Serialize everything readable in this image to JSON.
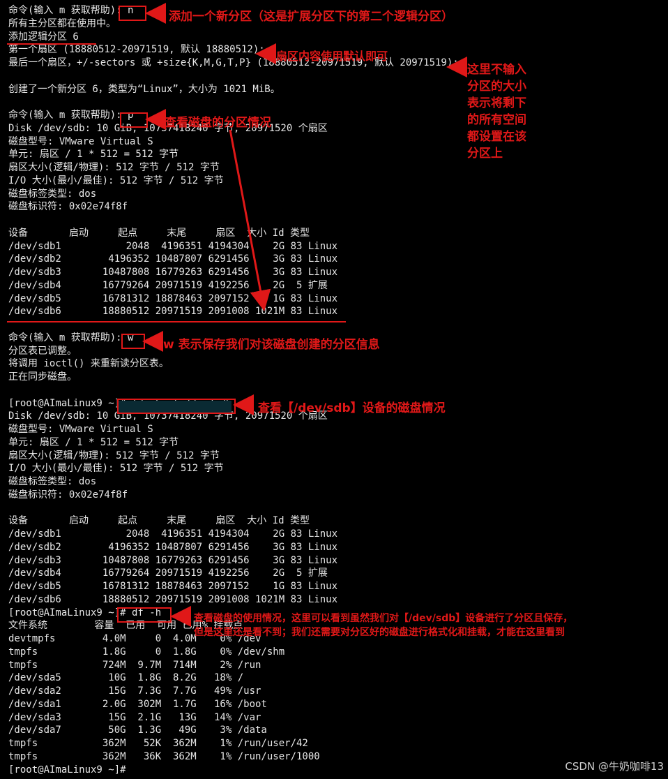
{
  "terminal_lines": [
    "命令(输入 m 获取帮助): n",
    "所有主分区都在使用中。",
    "添加逻辑分区 6",
    "第一个扇区 (18880512-20971519, 默认 18880512):",
    "最后一个扇区，+/-sectors 或 +size{K,M,G,T,P} (18880512-20971519, 默认 20971519):",
    "",
    "创建了一个新分区 6，类型为“Linux”，大小为 1021 MiB。",
    "",
    "命令(输入 m 获取帮助): p",
    "Disk /dev/sdb: 10 GiB, 10737418240 字节, 20971520 个扇区",
    "磁盘型号: VMware Virtual S",
    "单元: 扇区 / 1 * 512 = 512 字节",
    "扇区大小(逻辑/物理): 512 字节 / 512 字节",
    "I/O 大小(最小/最佳): 512 字节 / 512 字节",
    "磁盘标签类型: dos",
    "磁盘标识符: 0x02e74f8f",
    "",
    "设备       启动     起点     末尾     扇区  大小 Id 类型",
    "/dev/sdb1           2048  4196351 4194304    2G 83 Linux",
    "/dev/sdb2        4196352 10487807 6291456    3G 83 Linux",
    "/dev/sdb3       10487808 16779263 6291456    3G 83 Linux",
    "/dev/sdb4       16779264 20971519 4192256    2G  5 扩展",
    "/dev/sdb5       16781312 18878463 2097152    1G 83 Linux",
    "/dev/sdb6       18880512 20971519 2091008 1021M 83 Linux",
    "",
    "命令(输入 m 获取帮助): w",
    "分区表已调整。",
    "将调用 ioctl() 来重新读分区表。",
    "正在同步磁盘。",
    "",
    "[root@AImaLinux9 ~]# fdisk -l /dev/sdb",
    "Disk /dev/sdb: 10 GiB, 10737418240 字节, 20971520 个扇区",
    "磁盘型号: VMware Virtual S",
    "单元: 扇区 / 1 * 512 = 512 字节",
    "扇区大小(逻辑/物理): 512 字节 / 512 字节",
    "I/O 大小(最小/最佳): 512 字节 / 512 字节",
    "磁盘标签类型: dos",
    "磁盘标识符: 0x02e74f8f",
    "",
    "设备       启动     起点     末尾     扇区  大小 Id 类型",
    "/dev/sdb1           2048  4196351 4194304    2G 83 Linux",
    "/dev/sdb2        4196352 10487807 6291456    3G 83 Linux",
    "/dev/sdb3       10487808 16779263 6291456    3G 83 Linux",
    "/dev/sdb4       16779264 20971519 4192256    2G  5 扩展",
    "/dev/sdb5       16781312 18878463 2097152    1G 83 Linux",
    "/dev/sdb6       18880512 20971519 2091008 1021M 83 Linux",
    "[root@AImaLinux9 ~]# df -h",
    "文件系统        容量  已用  可用 已用% 挂载点",
    "devtmpfs        4.0M     0  4.0M    0% /dev",
    "tmpfs           1.8G     0  1.8G    0% /dev/shm",
    "tmpfs           724M  9.7M  714M    2% /run",
    "/dev/sda5        10G  1.8G  8.2G   18% /",
    "/dev/sda2        15G  7.3G  7.7G   49% /usr",
    "/dev/sda1       2.0G  302M  1.7G   16% /boot",
    "/dev/sda3        15G  2.1G   13G   14% /var",
    "/dev/sda7        50G  1.3G   49G    3% /data",
    "tmpfs           362M   52K  362M    1% /run/user/42",
    "tmpfs           362M   36K  362M    1% /run/user/1000",
    "[root@AImaLinux9 ~]#"
  ],
  "annotations": {
    "new_partition": "添加一个新分区（这是扩展分区下的第二个逻辑分区）",
    "sector_default": "扇区内容使用默认即可",
    "size_note": "这里不输入\n分区的大小\n表示将剩下\n的所有空间\n都设置在该\n分区上",
    "view_partitions": "查看磁盘的分区情况",
    "save_info": "w 表示保存我们对该磁盘创建的分区信息",
    "view_device": "查看【/dev/sdb】设备的磁盘情况",
    "df_note": "查看磁盘的使用情况，这里可以看到虽然我们对【/dev/sdb】设备进行了分区且保存，\n但是这里还是看不到；我们还需要对分区好的磁盘进行格式化和挂载，才能在这里看到"
  },
  "watermark": "CSDN @牛奶咖啡13",
  "colors": {
    "annotation": "#e01818",
    "number": "#b07fe0",
    "command": "#4fc3e8",
    "background": "#000000"
  }
}
